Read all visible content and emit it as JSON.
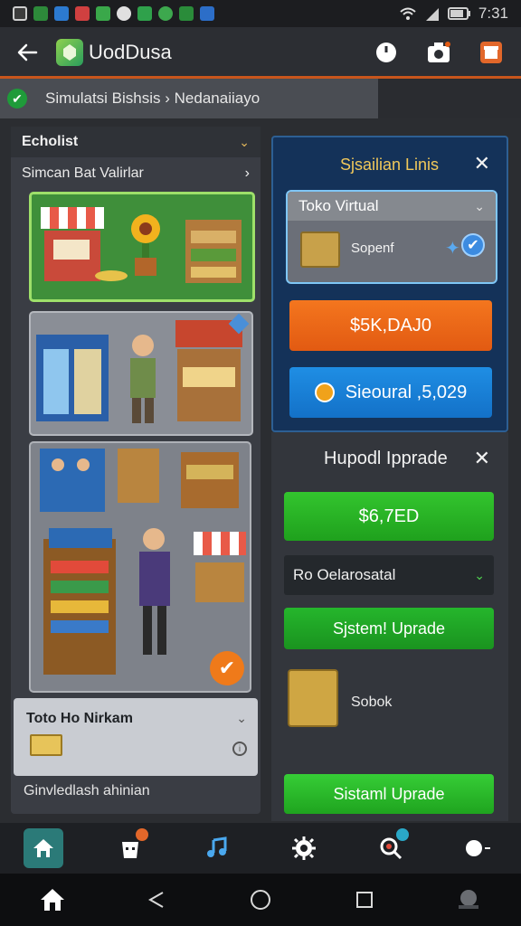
{
  "status_bar": {
    "time": "7:31"
  },
  "app_bar": {
    "title": "UodDusa",
    "back_icon": "arrow-left-icon",
    "action_icons": [
      "timer-icon",
      "camera-icon",
      "store-icon"
    ]
  },
  "breadcrumb": {
    "text": "Simulatsi Bishsis  ›  Nedanaiiayo"
  },
  "left_panel": {
    "header": "Echolist",
    "subheader": "Simcan Bat Valirlar",
    "item_row": {
      "title": "Toto Ho Nirkam"
    },
    "footer": "Ginvledlash ahinian"
  },
  "right_top": {
    "title": "Sjsailian Linis",
    "select_label": "Toko Virtual",
    "spend_label": "Sopenf",
    "price_button": "$5K,DAJ0",
    "secondary_button": "Sieoural ,5,029"
  },
  "right_bottom": {
    "title": "Hupodl Ipprade",
    "price_button": "$6,7ED",
    "select_label": "Ro Oelarosatal",
    "upgrade_button_1": "Sjstem! Uprade",
    "stock_label": "Sobok",
    "upgrade_button_2": "Sistaml Uprade"
  },
  "bottom_nav": {
    "items": [
      "home-icon",
      "shop-bag-icon",
      "music-icon",
      "settings-icon",
      "search-icon",
      "profile-icon"
    ]
  },
  "colors": {
    "accent_orange": "#e25a12",
    "accent_green": "#1fa11d",
    "accent_blue": "#1371c8",
    "title_gold": "#f1c85a"
  }
}
